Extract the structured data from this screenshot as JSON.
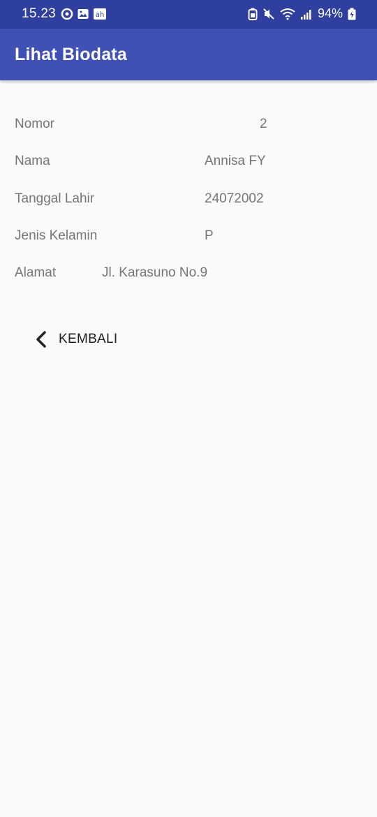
{
  "status_bar": {
    "time": "15.23",
    "battery_percent": "94%",
    "notification_icons": [
      "circle-app-icon",
      "gallery-icon",
      "app-badge-icon"
    ],
    "system_icons": [
      "battery-saver-icon",
      "mute-icon",
      "wifi-icon",
      "signal-icon",
      "battery-icon"
    ]
  },
  "app_bar": {
    "title": "Lihat Biodata",
    "color": "#3f51b5"
  },
  "biodata": {
    "nomor": {
      "label": "Nomor",
      "value": "2"
    },
    "nama": {
      "label": "Nama",
      "value": "Annisa FY"
    },
    "tanggal_lahir": {
      "label": "Tanggal Lahir",
      "value": "24072002"
    },
    "jenis_kelamin": {
      "label": "Jenis Kelamin",
      "value": "P"
    },
    "alamat": {
      "label": "Alamat",
      "value": "Jl. Karasuno No.9"
    }
  },
  "back_button": {
    "label": "KEMBALI",
    "icon": "chevron-left-icon"
  }
}
